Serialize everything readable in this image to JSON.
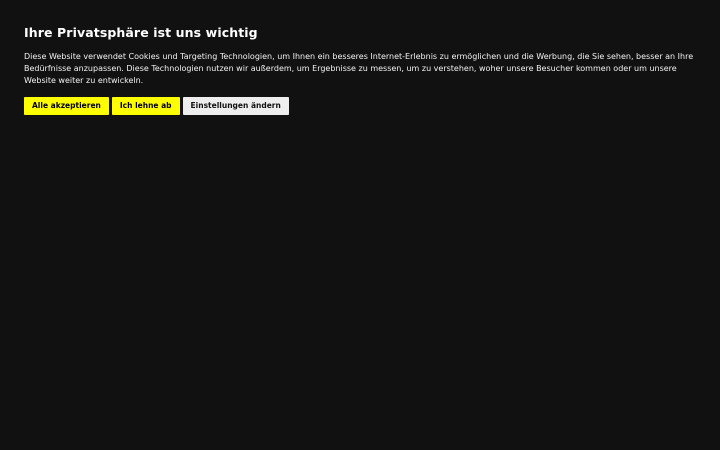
{
  "consent": {
    "title": "Ihre Privatsphäre ist uns wichtig",
    "description": "Diese Website verwendet Cookies und Targeting Technologien, um Ihnen ein besseres Internet-Erlebnis zu ermöglichen und die Werbung, die Sie sehen, besser an Ihre Bedürfnisse anzupassen. Diese Technologien nutzen wir außerdem, um Ergebnisse zu messen, um zu verstehen, woher unsere Besucher kommen oder um unsere Website weiter zu entwickeln.",
    "buttons": {
      "accept_all": "Alle akzeptieren",
      "reject": "Ich lehne ab",
      "settings": "Einstellungen ändern"
    }
  },
  "colors": {
    "background": "#111111",
    "accent": "#ffff00",
    "secondary_button": "#eeeeee",
    "text": "#ffffff"
  }
}
